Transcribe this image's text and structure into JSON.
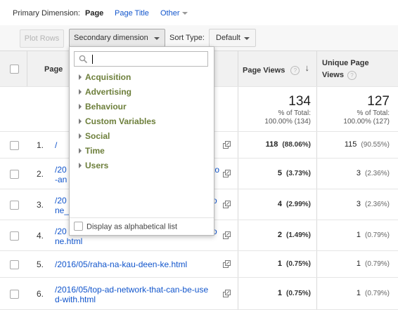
{
  "dimension_bar": {
    "label": "Primary Dimension:",
    "options": [
      "Page",
      "Page Title",
      "Other"
    ]
  },
  "toolbar": {
    "plot_rows": "Plot Rows",
    "secondary_dimension": "Secondary dimension",
    "sort_type_label": "Sort Type:",
    "sort_type_value": "Default"
  },
  "table": {
    "headers": {
      "page": "Page",
      "page_views": "Page Views",
      "unique_page_views": "Unique Page Views"
    },
    "totals": {
      "page_views": "134",
      "page_views_pct": "% of Total:",
      "page_views_sub": "100.00% (134)",
      "unique_page_views": "127",
      "unique_page_views_pct": "% of Total:",
      "unique_page_views_sub": "100.00% (127)"
    },
    "rows": [
      {
        "num": "1.",
        "page_l1": "/",
        "page_l2": "",
        "views": "118",
        "views_pct": "(88.06%)",
        "unique": "115",
        "unique_pct": "(90.55%)"
      },
      {
        "num": "2.",
        "page_l1": "/20",
        "page_l2": "-an",
        "page_r1": "to",
        "views": "5",
        "views_pct": "(3.73%)",
        "unique": "3",
        "unique_pct": "(2.36%)"
      },
      {
        "num": "3.",
        "page_l1": "/20",
        "page_l2": "ne_",
        "page_r1": "o",
        "views": "4",
        "views_pct": "(2.99%)",
        "unique": "3",
        "unique_pct": "(2.36%)"
      },
      {
        "num": "4.",
        "page_l1": "/20",
        "page_l2": "ne.html",
        "page_r1": "o",
        "views": "2",
        "views_pct": "(1.49%)",
        "unique": "1",
        "unique_pct": "(0.79%)"
      },
      {
        "num": "5.",
        "page_l1": "/2016/05/raha-na-kau-deen-ke.html",
        "page_l2": "",
        "views": "1",
        "views_pct": "(0.75%)",
        "unique": "1",
        "unique_pct": "(0.79%)"
      },
      {
        "num": "6.",
        "page_l1": "/2016/05/top-ad-network-that-can-be-use",
        "page_l2": "d-with.html",
        "views": "1",
        "views_pct": "(0.75%)",
        "unique": "1",
        "unique_pct": "(0.79%)"
      }
    ]
  },
  "dropdown": {
    "search_placeholder": "",
    "items": [
      "Acquisition",
      "Advertising",
      "Behaviour",
      "Custom Variables",
      "Social",
      "Time",
      "Users"
    ],
    "alphabetical_label": "Display as alphabetical list"
  },
  "colors": {
    "link": "#1155cc",
    "group": "#6d7f3b",
    "header_bg": "#f1f1f1"
  }
}
